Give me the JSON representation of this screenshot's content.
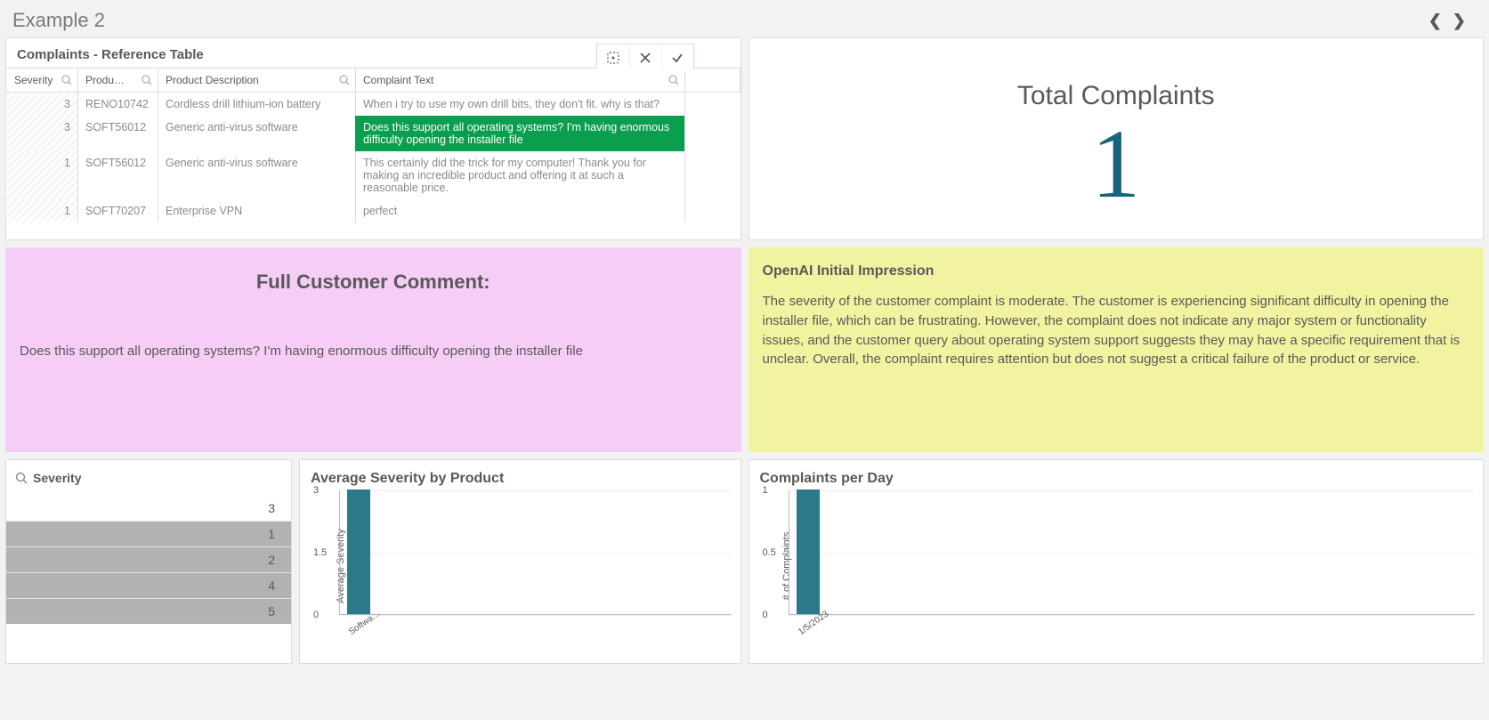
{
  "header": {
    "title": "Example 2"
  },
  "ref_table": {
    "title": "Complaints - Reference Table",
    "columns": {
      "severity": "Severity",
      "product": "Produ…",
      "description": "Product Description",
      "complaint": "Complaint Text"
    },
    "rows": [
      {
        "severity": "3",
        "product": "RENO10742",
        "description": "Cordless drill lithium-ion battery",
        "complaint": "When i try to use my own drill bits, they don't fit. why is that?",
        "selected": false
      },
      {
        "severity": "3",
        "product": "SOFT56012",
        "description": "Generic anti-virus software",
        "complaint": "Does this support all operating systems? I'm having enormous difficulty opening the installer file",
        "selected": true
      },
      {
        "severity": "1",
        "product": "SOFT56012",
        "description": "Generic anti-virus software",
        "complaint": "This certainly did the trick for my computer! Thank you for making an incredible product and offering it at such a reasonable price.",
        "selected": false
      },
      {
        "severity": "1",
        "product": "SOFT70207",
        "description": "Enterprise VPN",
        "complaint": "perfect",
        "selected": false
      }
    ]
  },
  "total_complaints": {
    "title": "Total Complaints",
    "value": "1"
  },
  "full_comment": {
    "title": "Full Customer Comment:",
    "body": "Does this support all operating systems? I'm having enormous difficulty opening the installer file"
  },
  "ai_impression": {
    "title": "OpenAI Initial Impression",
    "body": "The severity of the customer complaint is moderate. The customer is experiencing significant difficulty in opening the installer file, which can be frustrating. However, the complaint does not indicate any major system or functionality issues, and the customer query about operating system support suggests they may have a specific requirement that is unclear. Overall, the complaint requires attention but does not suggest a critical failure of the product or service."
  },
  "severity_filter": {
    "title": "Severity",
    "items": [
      {
        "value": "3",
        "highlighted": false
      },
      {
        "value": "1",
        "highlighted": true
      },
      {
        "value": "2",
        "highlighted": true
      },
      {
        "value": "4",
        "highlighted": true
      },
      {
        "value": "5",
        "highlighted": true
      }
    ]
  },
  "chart_data": [
    {
      "type": "bar",
      "title": "Average Severity by Product",
      "ylabel": "Average Severity",
      "categories": [
        "Softwa…"
      ],
      "values": [
        3
      ],
      "ylim": [
        0,
        3
      ],
      "yticks": [
        0,
        1.5,
        3
      ]
    },
    {
      "type": "bar",
      "title": "Complaints per Day",
      "ylabel": "# of Complaints",
      "categories": [
        "1/5/2023"
      ],
      "values": [
        1
      ],
      "ylim": [
        0,
        1
      ],
      "yticks": [
        0,
        0.5,
        1
      ]
    }
  ]
}
